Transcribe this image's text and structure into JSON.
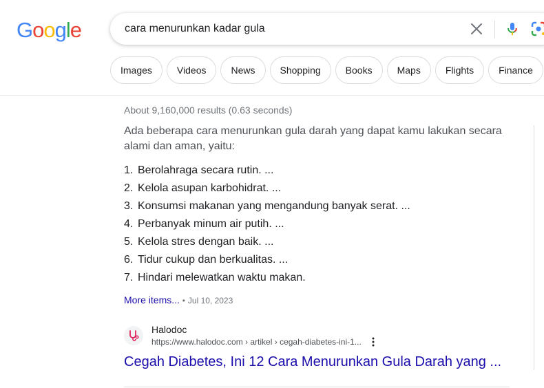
{
  "logo": {
    "letters": [
      "G",
      "o",
      "o",
      "g",
      "l",
      "e"
    ],
    "colors": [
      "#4285f4",
      "#ea4335",
      "#fbbc05",
      "#4285f4",
      "#34a853",
      "#ea4335"
    ]
  },
  "search": {
    "query": "cara menurunkan kadar gula",
    "icons": [
      "close-icon",
      "mic-icon",
      "lens-icon"
    ]
  },
  "tabs": [
    "Images",
    "Videos",
    "News",
    "Shopping",
    "Books",
    "Maps",
    "Flights",
    "Finance"
  ],
  "results": {
    "stats": "About 9,160,000 results (0.63 seconds)",
    "snippet": {
      "intro": "Ada beberapa cara menurunkan gula darah yang dapat kamu lakukan secara alami dan aman, yaitu:",
      "steps": [
        {
          "num": "1.",
          "text": "Berolahraga secara rutin. ..."
        },
        {
          "num": "2.",
          "text": "Kelola asupan karbohidrat. ..."
        },
        {
          "num": "3.",
          "text": "Konsumsi makanan yang mengandung banyak serat. ..."
        },
        {
          "num": "4.",
          "text": "Perbanyak minum air putih. ..."
        },
        {
          "num": "5.",
          "text": "Kelola stres dengan baik. ..."
        },
        {
          "num": "6.",
          "text": "Tidur cukup dan berkualitas. ..."
        },
        {
          "num": "7.",
          "text": "Hindari melewatkan waktu makan."
        }
      ],
      "more_label": "More items...",
      "separator": "•",
      "date": "Jul 10, 2023"
    },
    "source": {
      "site_name": "Halodoc",
      "url": "https://www.halodoc.com › artikel › cegah-diabetes-ini-1...",
      "favicon": "stethoscope-icon"
    },
    "title": "Cegah Diabetes, Ini 12 Cara Menurunkan Gula Darah yang ..."
  },
  "colors": {
    "link": "#1a0dab",
    "favicon": "#e0245e",
    "muted": "#70757a"
  }
}
